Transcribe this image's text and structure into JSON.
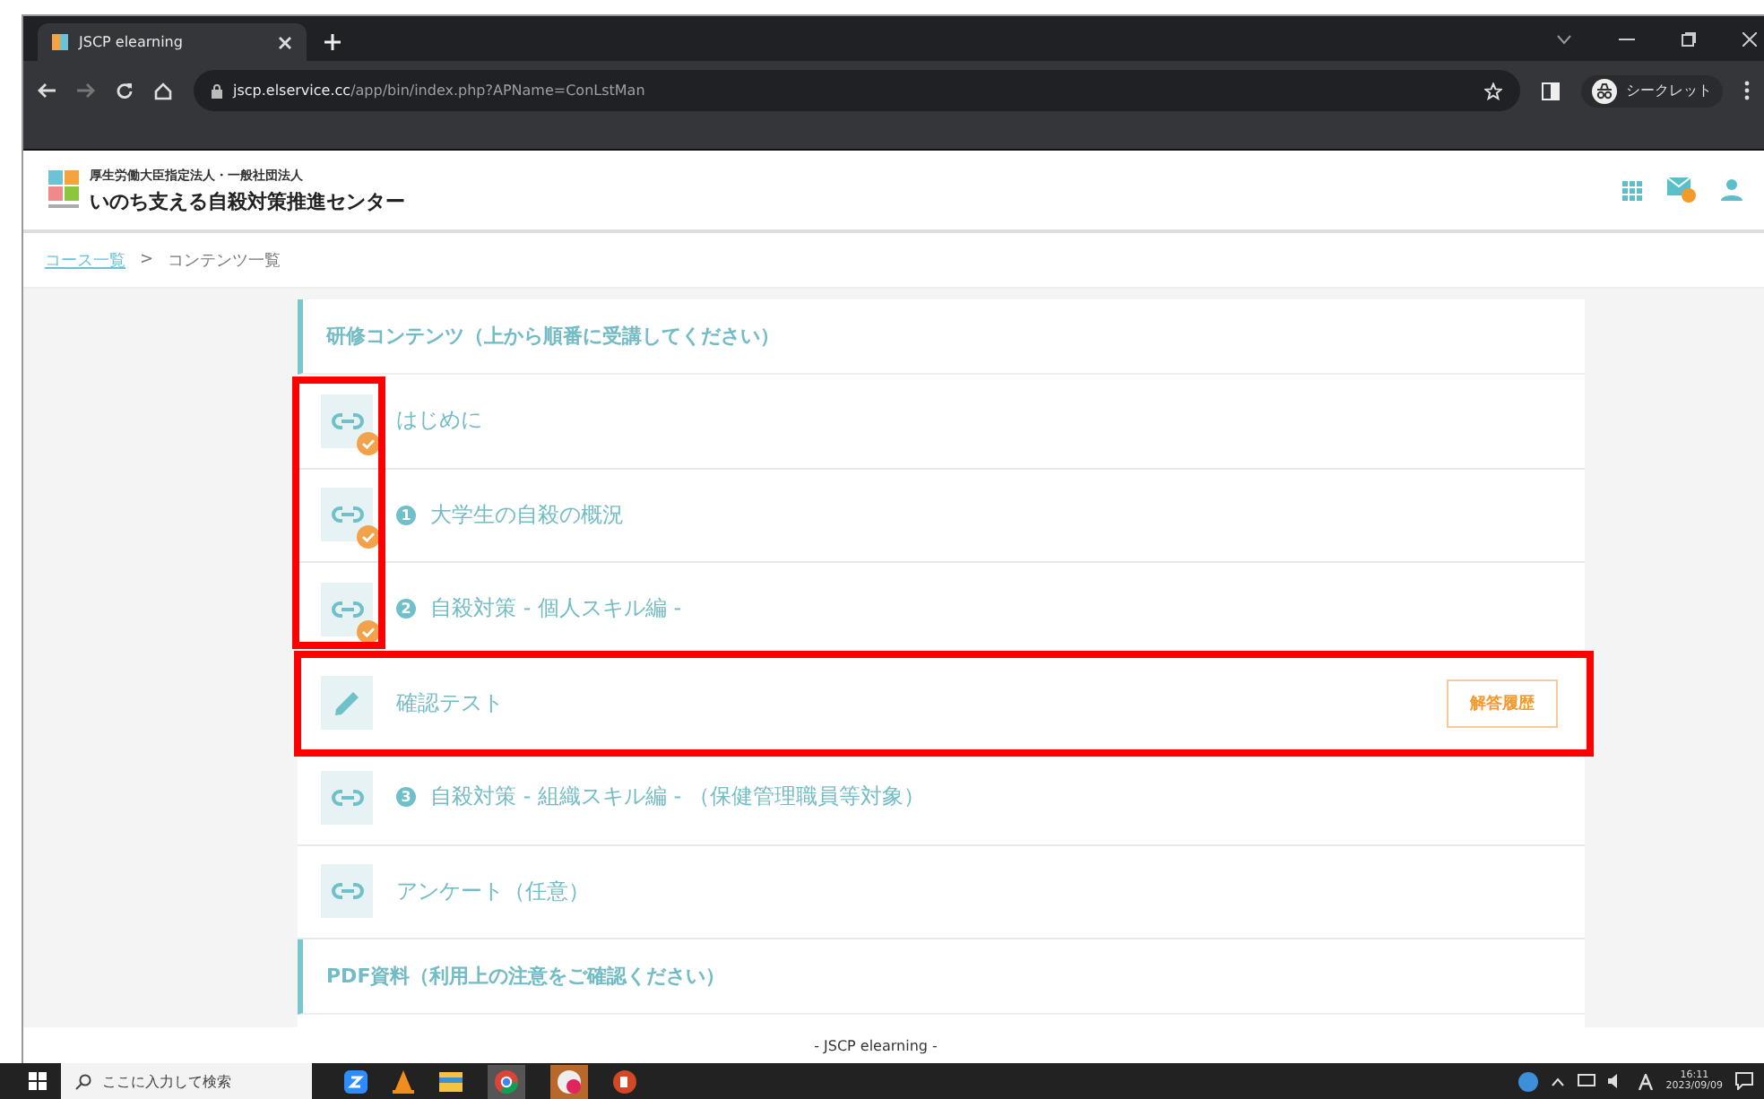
{
  "browser": {
    "tab_title": "JSCP elearning",
    "url_host": "jscp.elservice.cc",
    "url_path": "/app/bin/index.php?APName=ConLstMan",
    "profile": "シークレット"
  },
  "site": {
    "org_line": "厚生労働大臣指定法人・一般社団法人",
    "name": "いのち支える自殺対策推進センター",
    "mail_alert": true
  },
  "breadcrumb": [
    {
      "label": "コース一覧",
      "link": true
    },
    {
      "label": "コンテンツ一覧",
      "link": false
    }
  ],
  "breadcrumb_separator": ">",
  "sections": [
    {
      "title": "研修コンテンツ（上から順番に受講してください）",
      "items": [
        {
          "kind": "link",
          "label": "はじめに",
          "completed": true
        },
        {
          "kind": "link",
          "number": "1",
          "label": "大学生の自殺の概況",
          "completed": true
        },
        {
          "kind": "link",
          "number": "2",
          "label": "自殺対策 - 個人スキル編 -",
          "completed": true
        },
        {
          "kind": "test",
          "label": "確認テスト",
          "completed": false,
          "button": "解答履歴"
        },
        {
          "kind": "link",
          "number": "3",
          "label": "自殺対策 - 組織スキル編 - （保健管理職員等対象）",
          "completed": false
        },
        {
          "kind": "link",
          "label": "アンケート（任意）",
          "completed": false
        }
      ]
    },
    {
      "title": "PDF資料（利用上の注意をご確認ください）"
    }
  ],
  "footer": "- JSCP elearning -",
  "taskbar": {
    "search_placeholder": "ここに入力して検索",
    "time": "16:11",
    "date": "2023/09/09"
  }
}
